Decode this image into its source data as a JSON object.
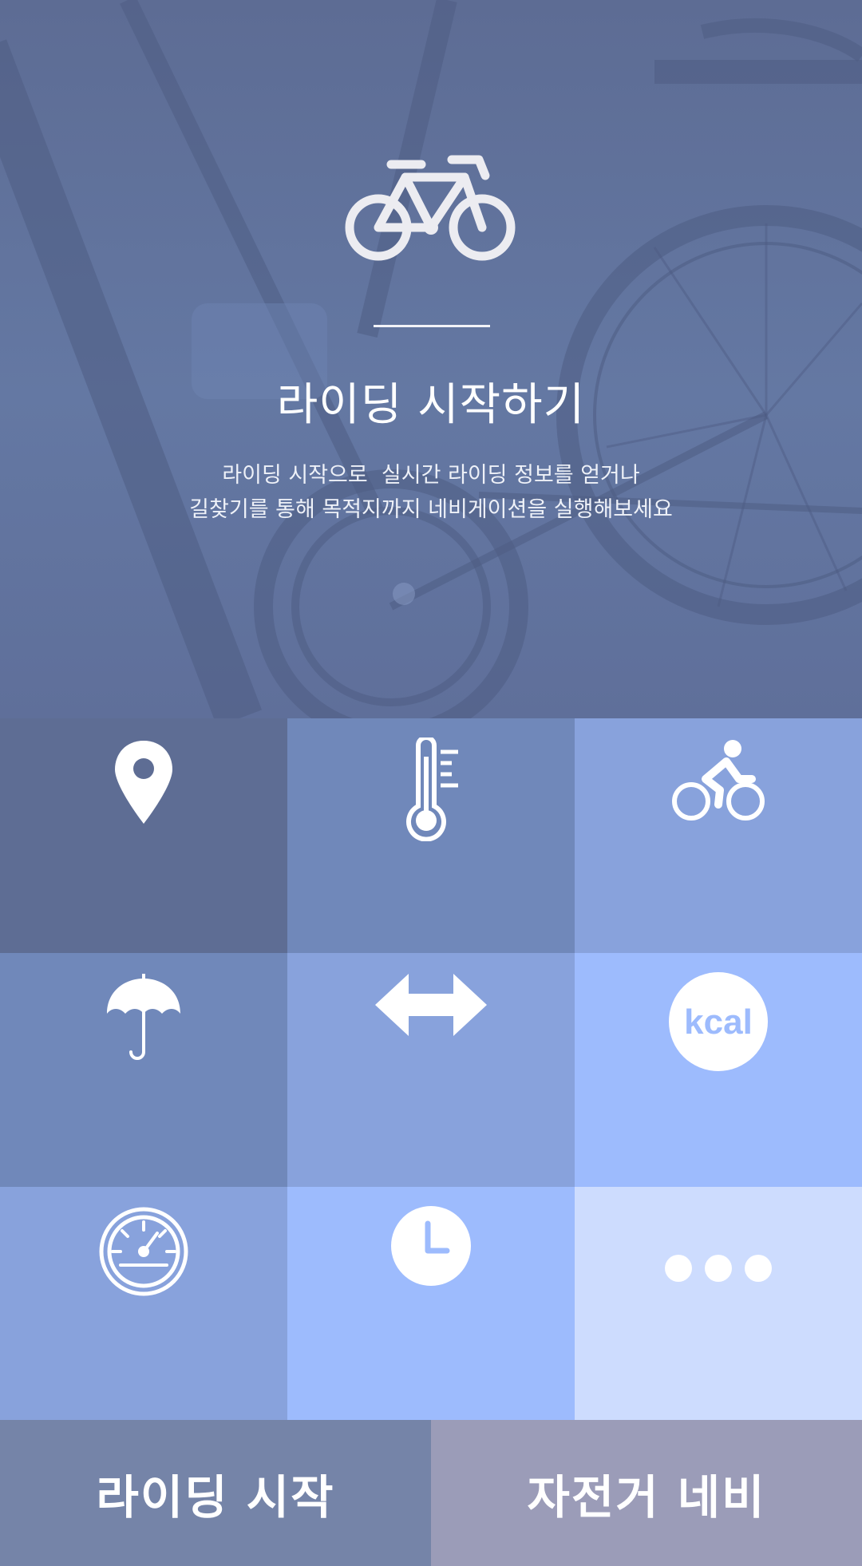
{
  "hero": {
    "title": "라이딩 시작하기",
    "description_lines": [
      "라이딩 시작으로  실시간 라이딩 정보를 얻거나",
      "길찾기를 통해 목적지까지 네비게이션을 실행해보세요"
    ],
    "icon": "bicycle-icon"
  },
  "tiles": [
    {
      "icon": "map-pin-icon",
      "color": "#5e6d94"
    },
    {
      "icon": "thermometer-icon",
      "color": "#7088ba"
    },
    {
      "icon": "cyclist-icon",
      "color": "#88a2dc"
    },
    {
      "icon": "umbrella-icon",
      "color": "#7088ba"
    },
    {
      "icon": "distance-arrows-icon",
      "color": "#88a2dc"
    },
    {
      "icon": "kcal-icon",
      "label": "kcal",
      "color": "#9dbbfd"
    },
    {
      "icon": "speedometer-icon",
      "color": "#88a2dc"
    },
    {
      "icon": "clock-icon",
      "color": "#9dbbfd"
    },
    {
      "icon": "more-icon",
      "color": "#cddcfe"
    }
  ],
  "actions": {
    "start_riding_label": "라이딩 시작",
    "bike_navi_label": "자전거 네비",
    "start_color": "#7584a8",
    "navi_color": "#9b9cb8"
  }
}
